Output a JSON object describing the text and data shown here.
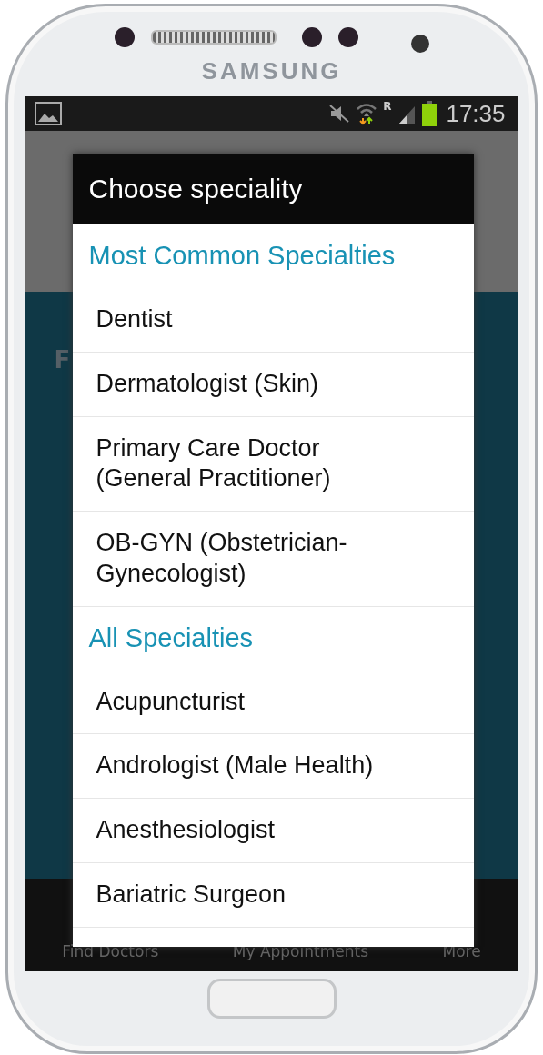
{
  "device": {
    "brand": "SAMSUNG"
  },
  "status_bar": {
    "roaming": "R",
    "time": "17:35"
  },
  "background": {
    "heading": "F",
    "tabs": [
      {
        "label": "Find Doctors",
        "selected": false
      },
      {
        "label": "My Appointments",
        "selected": false
      },
      {
        "label": "More",
        "selected": false
      }
    ]
  },
  "dialog": {
    "title": "Choose speciality",
    "items": [
      {
        "kind": "header",
        "label": "Most Common Specialties"
      },
      {
        "kind": "option",
        "label": "Dentist"
      },
      {
        "kind": "option",
        "label": "Dermatologist (Skin)"
      },
      {
        "kind": "option",
        "label": "Primary Care Doctor (General Practitioner)"
      },
      {
        "kind": "option",
        "label": "OB-GYN (Obstetrician-Gynecologist)"
      },
      {
        "kind": "header",
        "label": "All Specialties"
      },
      {
        "kind": "option",
        "label": "Acupuncturist"
      },
      {
        "kind": "option",
        "label": "Andrologist (Male Health)"
      },
      {
        "kind": "option",
        "label": "Anesthesiologist"
      },
      {
        "kind": "option",
        "label": "Bariatric Surgeon"
      }
    ]
  }
}
